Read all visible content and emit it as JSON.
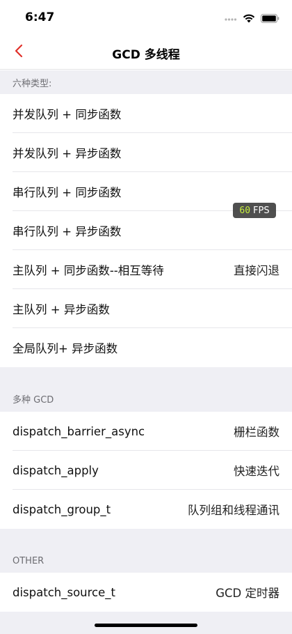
{
  "status_bar": {
    "time": "6:47"
  },
  "nav": {
    "title": "GCD 多线程"
  },
  "colors": {
    "accent": "#e0302a",
    "section_bg": "#efeff4",
    "fps_value": "#c6ef3d"
  },
  "sections": [
    {
      "header": "六种类型:",
      "rows": [
        {
          "label": "并发队列 + 同步函数",
          "detail": ""
        },
        {
          "label": "并发队列 + 异步函数",
          "detail": ""
        },
        {
          "label": "串行队列 + 同步函数",
          "detail": ""
        },
        {
          "label": "串行队列 + 异步函数",
          "detail": ""
        },
        {
          "label": "主队列 + 同步函数--相互等待",
          "detail": "直接闪退"
        },
        {
          "label": "主队列 + 异步函数",
          "detail": ""
        },
        {
          "label": "全局队列+ 异步函数",
          "detail": ""
        }
      ]
    },
    {
      "header": "多种 GCD",
      "rows": [
        {
          "label": "dispatch_barrier_async",
          "detail": "栅栏函数"
        },
        {
          "label": "dispatch_apply",
          "detail": "快速迭代"
        },
        {
          "label": "dispatch_group_t",
          "detail": "队列组和线程通讯"
        }
      ]
    },
    {
      "header": "OTHER",
      "rows": [
        {
          "label": "dispatch_source_t",
          "detail": "GCD 定时器"
        }
      ]
    }
  ],
  "fps": {
    "value": "60",
    "label": "FPS"
  }
}
